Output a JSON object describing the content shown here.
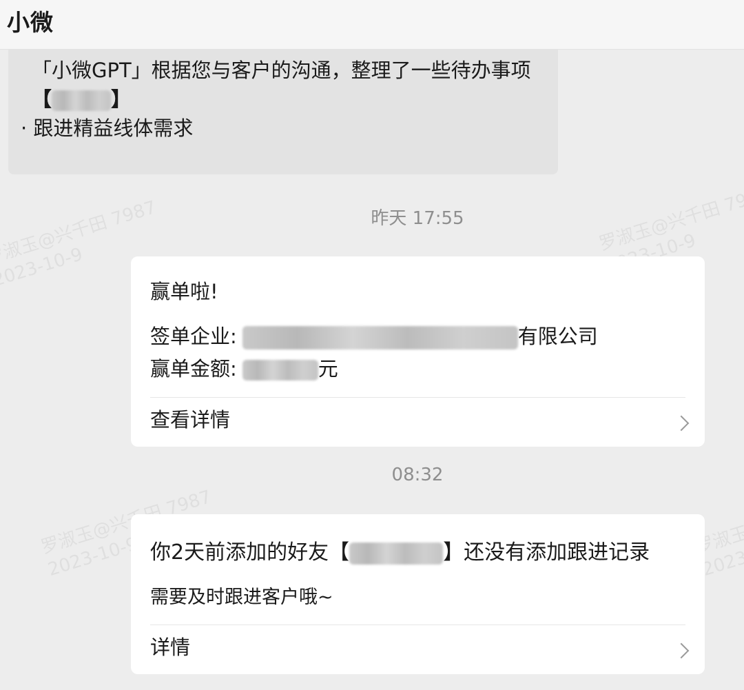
{
  "header": {
    "title": "小微"
  },
  "gpt_message": {
    "line1": "「小微GPT」根据您与客户的沟通，整理了一些待办事项",
    "tag_open": "【",
    "tag_close": "】",
    "bullet": "· 跟进精益线体需求"
  },
  "timestamps": {
    "first": "昨天 17:55",
    "second": "08:32"
  },
  "win_card": {
    "title": "赢单啦!",
    "company_label": "签单企业:",
    "company_suffix": "有限公司",
    "amount_label": "赢单金额:",
    "amount_unit": "元",
    "link": "查看详情"
  },
  "reminder_card": {
    "title_prefix": "你2天前添加的好友【",
    "title_suffix": "】还没有添加跟进记录",
    "subtitle": "需要及时跟进客户哦~",
    "link": "详情"
  },
  "watermarks": {
    "name": "罗淑玉@兴千田 7987",
    "date": "2023-10-9"
  }
}
